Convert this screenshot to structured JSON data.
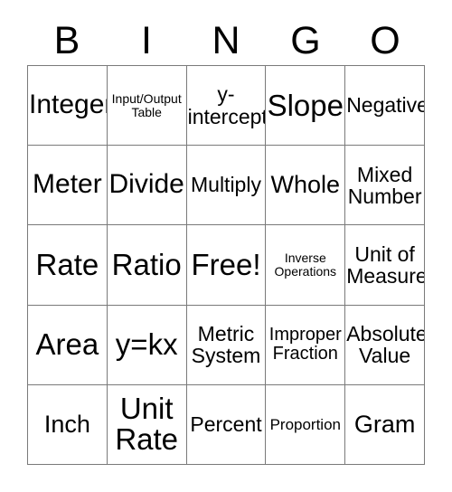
{
  "card": {
    "title": "BINGO",
    "header_letters": [
      "B",
      "I",
      "N",
      "G",
      "O"
    ],
    "free_space_label": "Free!",
    "rows": [
      [
        {
          "label": "Integer",
          "size": "lg"
        },
        {
          "label": "Input/Output\nTable",
          "size": "xxs"
        },
        {
          "label": "y-\nintercept",
          "size": "md"
        },
        {
          "label": "Slope",
          "size": "xl"
        },
        {
          "label": "Negative",
          "size": "md"
        }
      ],
      [
        {
          "label": "Meter",
          "size": "lg"
        },
        {
          "label": "Divide",
          "size": "lg"
        },
        {
          "label": "Multiply",
          "size": "md"
        },
        {
          "label": "Whole",
          "size": "ml"
        },
        {
          "label": "Mixed\nNumber",
          "size": "md"
        }
      ],
      [
        {
          "label": "Rate",
          "size": "xl"
        },
        {
          "label": "Ratio",
          "size": "xl"
        },
        {
          "label": "Free!",
          "size": "xl"
        },
        {
          "label": "Inverse\nOperations",
          "size": "xxs"
        },
        {
          "label": "Unit of\nMeasure",
          "size": "md"
        }
      ],
      [
        {
          "label": "Area",
          "size": "xl"
        },
        {
          "label": "y=kx",
          "size": "xl"
        },
        {
          "label": "Metric\nSystem",
          "size": "md"
        },
        {
          "label": "Improper\nFraction",
          "size": "sm"
        },
        {
          "label": "Absolute\nValue",
          "size": "md"
        }
      ],
      [
        {
          "label": "Inch",
          "size": "ml"
        },
        {
          "label": "Unit\nRate",
          "size": "xl"
        },
        {
          "label": "Percent",
          "size": "md"
        },
        {
          "label": "Proportion",
          "size": "xs"
        },
        {
          "label": "Gram",
          "size": "ml"
        }
      ]
    ],
    "colors": {
      "border": "#7a7a7a",
      "text": "#000000",
      "background": "#ffffff"
    }
  }
}
